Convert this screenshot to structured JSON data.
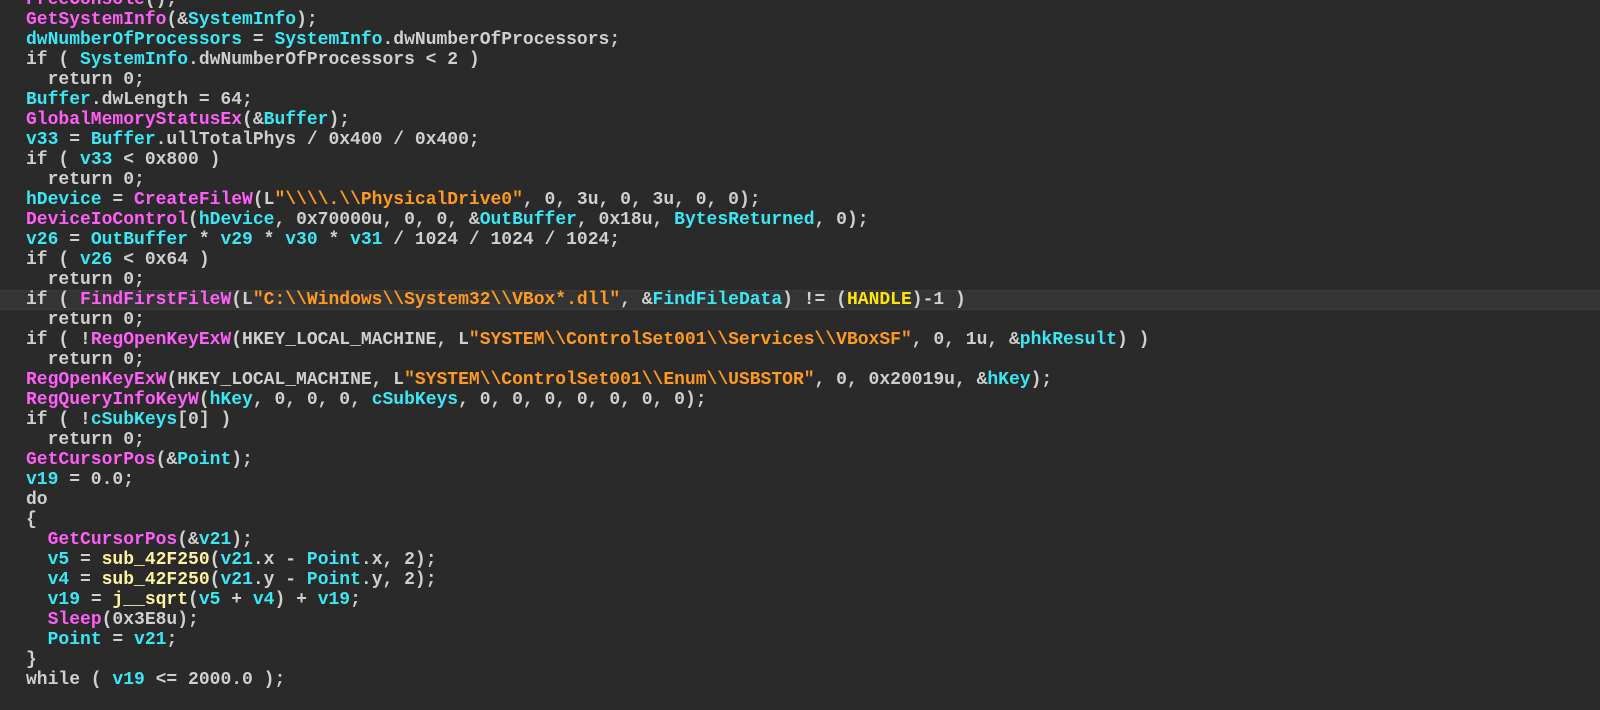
{
  "palette": {
    "background": "#2a2a2a",
    "plain": "#cfcfcf",
    "function": "#ff5ef7",
    "variable": "#38e8f5",
    "string": "#ff9a1f",
    "sub_function": "#fff2a0",
    "macro": "#ffe600"
  },
  "code": {
    "highlighted_line": 15,
    "lines": [
      [
        {
          "t": "FreeConsole",
          "k": "func"
        },
        {
          "t": "();",
          "k": "plain"
        }
      ],
      [
        {
          "t": "GetSystemInfo",
          "k": "func"
        },
        {
          "t": "(&",
          "k": "plain"
        },
        {
          "t": "SystemInfo",
          "k": "var"
        },
        {
          "t": ");",
          "k": "plain"
        }
      ],
      [
        {
          "t": "dwNumberOfProcessors",
          "k": "var"
        },
        {
          "t": " = ",
          "k": "plain"
        },
        {
          "t": "SystemInfo",
          "k": "var"
        },
        {
          "t": ".dwNumberOfProcessors;",
          "k": "plain"
        }
      ],
      [
        {
          "t": "if ( ",
          "k": "plain"
        },
        {
          "t": "SystemInfo",
          "k": "var"
        },
        {
          "t": ".dwNumberOfProcessors < 2 )",
          "k": "plain"
        }
      ],
      [
        {
          "t": "  return 0;",
          "k": "plain"
        }
      ],
      [
        {
          "t": "Buffer",
          "k": "var"
        },
        {
          "t": ".dwLength = 64;",
          "k": "plain"
        }
      ],
      [
        {
          "t": "GlobalMemoryStatusEx",
          "k": "func"
        },
        {
          "t": "(&",
          "k": "plain"
        },
        {
          "t": "Buffer",
          "k": "var"
        },
        {
          "t": ");",
          "k": "plain"
        }
      ],
      [
        {
          "t": "v33",
          "k": "var"
        },
        {
          "t": " = ",
          "k": "plain"
        },
        {
          "t": "Buffer",
          "k": "var"
        },
        {
          "t": ".ullTotalPhys / 0x400 / 0x400;",
          "k": "plain"
        }
      ],
      [
        {
          "t": "if ( ",
          "k": "plain"
        },
        {
          "t": "v33",
          "k": "var"
        },
        {
          "t": " < 0x800 )",
          "k": "plain"
        }
      ],
      [
        {
          "t": "  return 0;",
          "k": "plain"
        }
      ],
      [
        {
          "t": "hDevice",
          "k": "var"
        },
        {
          "t": " = ",
          "k": "plain"
        },
        {
          "t": "CreateFileW",
          "k": "func"
        },
        {
          "t": "(L",
          "k": "plain"
        },
        {
          "t": "\"\\\\\\\\.\\\\PhysicalDrive0\"",
          "k": "str"
        },
        {
          "t": ", 0, 3u, 0, 3u, 0, 0);",
          "k": "plain"
        }
      ],
      [
        {
          "t": "DeviceIoControl",
          "k": "func"
        },
        {
          "t": "(",
          "k": "plain"
        },
        {
          "t": "hDevice",
          "k": "var"
        },
        {
          "t": ", 0x70000u, 0, 0, &",
          "k": "plain"
        },
        {
          "t": "OutBuffer",
          "k": "var"
        },
        {
          "t": ", 0x18u, ",
          "k": "plain"
        },
        {
          "t": "BytesReturned",
          "k": "var"
        },
        {
          "t": ", 0);",
          "k": "plain"
        }
      ],
      [
        {
          "t": "v26",
          "k": "var"
        },
        {
          "t": " = ",
          "k": "plain"
        },
        {
          "t": "OutBuffer",
          "k": "var"
        },
        {
          "t": " * ",
          "k": "plain"
        },
        {
          "t": "v29",
          "k": "var"
        },
        {
          "t": " * ",
          "k": "plain"
        },
        {
          "t": "v30",
          "k": "var"
        },
        {
          "t": " * ",
          "k": "plain"
        },
        {
          "t": "v31",
          "k": "var"
        },
        {
          "t": " / 1024 / 1024 / 1024;",
          "k": "plain"
        }
      ],
      [
        {
          "t": "if ( ",
          "k": "plain"
        },
        {
          "t": "v26",
          "k": "var"
        },
        {
          "t": " < 0x64 )",
          "k": "plain"
        }
      ],
      [
        {
          "t": "  return 0;",
          "k": "plain"
        }
      ],
      [
        {
          "t": "if ( ",
          "k": "plain"
        },
        {
          "t": "FindFirstFileW",
          "k": "func"
        },
        {
          "t": "(L",
          "k": "plain"
        },
        {
          "t": "\"C:\\\\Windows\\\\System32\\\\VBox*.dll\"",
          "k": "str"
        },
        {
          "t": ", &",
          "k": "plain"
        },
        {
          "t": "FindFileData",
          "k": "var"
        },
        {
          "t": ") != (",
          "k": "plain"
        },
        {
          "t": "HANDLE",
          "k": "macro"
        },
        {
          "t": ")-1 )",
          "k": "plain"
        }
      ],
      [
        {
          "t": "  return 0;",
          "k": "plain"
        }
      ],
      [
        {
          "t": "if ( !",
          "k": "plain"
        },
        {
          "t": "RegOpenKeyExW",
          "k": "func"
        },
        {
          "t": "(HKEY_LOCAL_MACHINE, L",
          "k": "plain"
        },
        {
          "t": "\"SYSTEM\\\\ControlSet001\\\\Services\\\\VBoxSF\"",
          "k": "str"
        },
        {
          "t": ", 0, 1u, &",
          "k": "plain"
        },
        {
          "t": "phkResult",
          "k": "var"
        },
        {
          "t": ") )",
          "k": "plain"
        }
      ],
      [
        {
          "t": "  return 0;",
          "k": "plain"
        }
      ],
      [
        {
          "t": "RegOpenKeyExW",
          "k": "func"
        },
        {
          "t": "(HKEY_LOCAL_MACHINE, L",
          "k": "plain"
        },
        {
          "t": "\"SYSTEM\\\\ControlSet001\\\\Enum\\\\USBSTOR\"",
          "k": "str"
        },
        {
          "t": ", 0, 0x20019u, &",
          "k": "plain"
        },
        {
          "t": "hKey",
          "k": "var"
        },
        {
          "t": ");",
          "k": "plain"
        }
      ],
      [
        {
          "t": "RegQueryInfoKeyW",
          "k": "func"
        },
        {
          "t": "(",
          "k": "plain"
        },
        {
          "t": "hKey",
          "k": "var"
        },
        {
          "t": ", 0, 0, 0, ",
          "k": "plain"
        },
        {
          "t": "cSubKeys",
          "k": "var"
        },
        {
          "t": ", 0, 0, 0, 0, 0, 0, 0);",
          "k": "plain"
        }
      ],
      [
        {
          "t": "if ( !",
          "k": "plain"
        },
        {
          "t": "cSubKeys",
          "k": "var"
        },
        {
          "t": "[0] )",
          "k": "plain"
        }
      ],
      [
        {
          "t": "  return 0;",
          "k": "plain"
        }
      ],
      [
        {
          "t": "GetCursorPos",
          "k": "func"
        },
        {
          "t": "(&",
          "k": "plain"
        },
        {
          "t": "Point",
          "k": "var"
        },
        {
          "t": ");",
          "k": "plain"
        }
      ],
      [
        {
          "t": "v19",
          "k": "var"
        },
        {
          "t": " = 0.0;",
          "k": "plain"
        }
      ],
      [
        {
          "t": "do",
          "k": "plain"
        }
      ],
      [
        {
          "t": "{",
          "k": "plain"
        }
      ],
      [
        {
          "t": "  ",
          "k": "plain"
        },
        {
          "t": "GetCursorPos",
          "k": "func"
        },
        {
          "t": "(&",
          "k": "plain"
        },
        {
          "t": "v21",
          "k": "var"
        },
        {
          "t": ");",
          "k": "plain"
        }
      ],
      [
        {
          "t": "  ",
          "k": "plain"
        },
        {
          "t": "v5",
          "k": "var"
        },
        {
          "t": " = ",
          "k": "plain"
        },
        {
          "t": "sub_42F250",
          "k": "sub"
        },
        {
          "t": "(",
          "k": "plain"
        },
        {
          "t": "v21",
          "k": "var"
        },
        {
          "t": ".x - ",
          "k": "plain"
        },
        {
          "t": "Point",
          "k": "var"
        },
        {
          "t": ".x, 2);",
          "k": "plain"
        }
      ],
      [
        {
          "t": "  ",
          "k": "plain"
        },
        {
          "t": "v4",
          "k": "var"
        },
        {
          "t": " = ",
          "k": "plain"
        },
        {
          "t": "sub_42F250",
          "k": "sub"
        },
        {
          "t": "(",
          "k": "plain"
        },
        {
          "t": "v21",
          "k": "var"
        },
        {
          "t": ".y - ",
          "k": "plain"
        },
        {
          "t": "Point",
          "k": "var"
        },
        {
          "t": ".y, 2);",
          "k": "plain"
        }
      ],
      [
        {
          "t": "  ",
          "k": "plain"
        },
        {
          "t": "v19",
          "k": "var"
        },
        {
          "t": " = ",
          "k": "plain"
        },
        {
          "t": "j__sqrt",
          "k": "sub"
        },
        {
          "t": "(",
          "k": "plain"
        },
        {
          "t": "v5",
          "k": "var"
        },
        {
          "t": " + ",
          "k": "plain"
        },
        {
          "t": "v4",
          "k": "var"
        },
        {
          "t": ") + ",
          "k": "plain"
        },
        {
          "t": "v19",
          "k": "var"
        },
        {
          "t": ";",
          "k": "plain"
        }
      ],
      [
        {
          "t": "  ",
          "k": "plain"
        },
        {
          "t": "Sleep",
          "k": "func"
        },
        {
          "t": "(0x3E8u);",
          "k": "plain"
        }
      ],
      [
        {
          "t": "  ",
          "k": "plain"
        },
        {
          "t": "Point",
          "k": "var"
        },
        {
          "t": " = ",
          "k": "plain"
        },
        {
          "t": "v21",
          "k": "var"
        },
        {
          "t": ";",
          "k": "plain"
        }
      ],
      [
        {
          "t": "}",
          "k": "plain"
        }
      ],
      [
        {
          "t": "while ( ",
          "k": "plain"
        },
        {
          "t": "v19",
          "k": "var"
        },
        {
          "t": " <= 2000.0 );",
          "k": "plain"
        }
      ]
    ]
  }
}
